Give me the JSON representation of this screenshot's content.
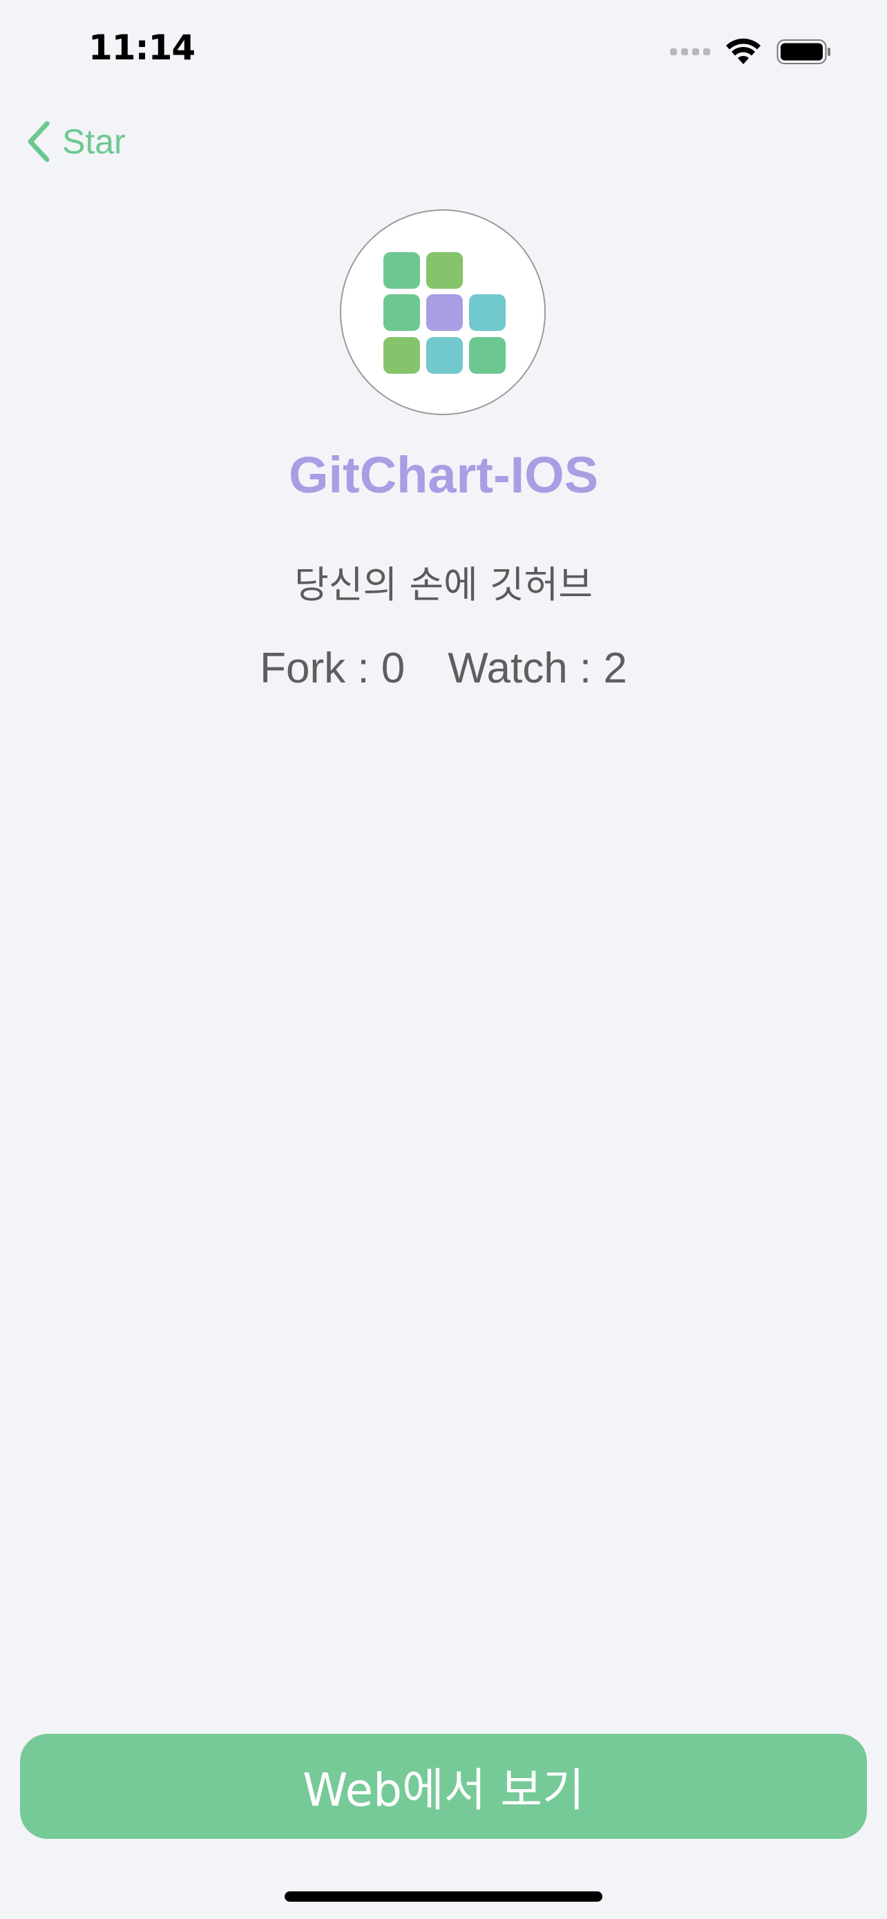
{
  "status_bar": {
    "time": "11:14",
    "icons": [
      "cellular-signal-icon",
      "wifi-icon",
      "battery-icon"
    ],
    "battery_level": 1.0
  },
  "nav": {
    "back_label": "Star",
    "back_icon": "chevron-left-icon",
    "accent_color": "#6cc890"
  },
  "repo": {
    "name": "GitChart-IOS",
    "name_color": "#a99de3",
    "description": "당신의 손에 깃허브",
    "fork_text": "Fork : 0",
    "watch_text": "Watch : 2",
    "avatar_icon": "gitchart-grid-logo-icon",
    "logo_colors": {
      "green": "#6cc890",
      "lime": "#85c46a",
      "purple": "#a99de3",
      "teal": "#72c9cd"
    }
  },
  "actions": {
    "web_button_label": "Web에서 보기",
    "web_button_color": "#76ca98"
  }
}
